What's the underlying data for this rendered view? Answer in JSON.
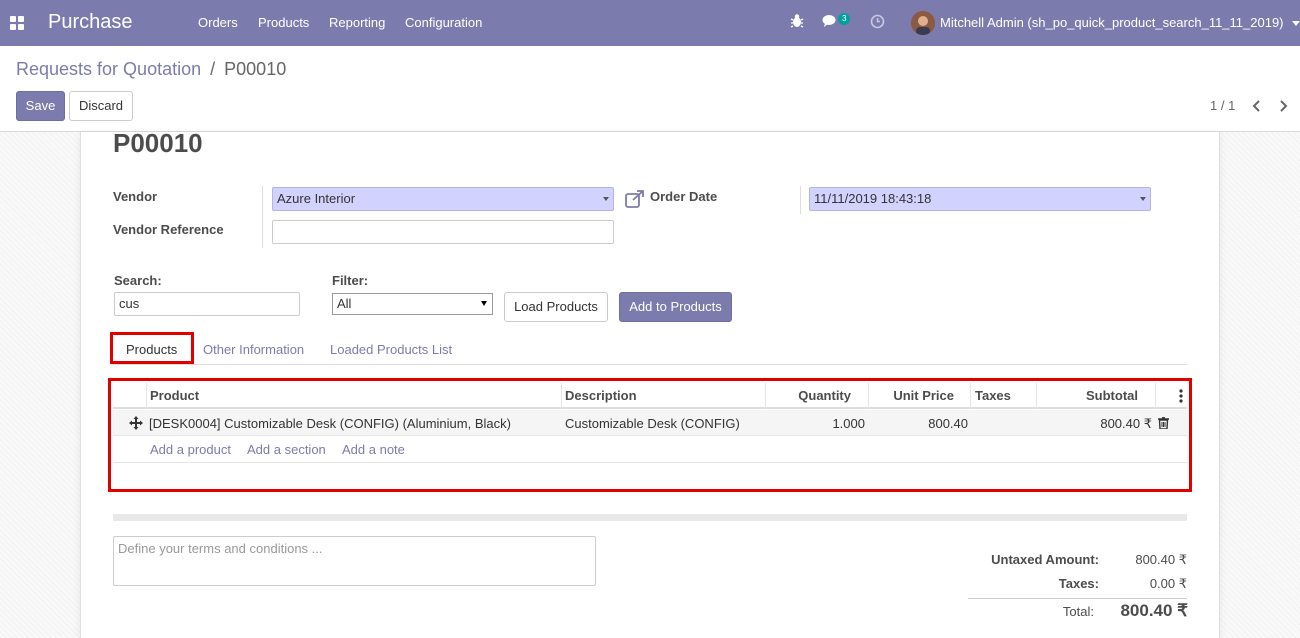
{
  "navbar": {
    "app_name": "Purchase",
    "menu": [
      "Orders",
      "Products",
      "Reporting",
      "Configuration"
    ],
    "chat_count": "3",
    "user": "Mitchell Admin (sh_po_quick_product_search_11_11_2019)",
    "bar_color": "#7c7bad"
  },
  "control": {
    "breadcrumb_parent": "Requests for Quotation",
    "breadcrumb_sep": "/",
    "breadcrumb_current": "P00010",
    "save_label": "Save",
    "discard_label": "Discard",
    "pager": "1 / 1"
  },
  "form": {
    "title": "P00010",
    "vendor_label": "Vendor",
    "vendor_value": "Azure Interior",
    "vendor_ref_label": "Vendor Reference",
    "vendor_ref_value": "",
    "order_date_label": "Order Date",
    "order_date_value": "11/11/2019 18:43:18"
  },
  "quick_search": {
    "search_label": "Search:",
    "search_value": "cus",
    "filter_label": "Filter:",
    "filter_value": "All",
    "load_label": "Load Products",
    "add_label": "Add to Products"
  },
  "tabs": [
    "Products",
    "Other Information",
    "Loaded Products List"
  ],
  "lines": {
    "headers": [
      "Product",
      "Description",
      "Quantity",
      "Unit Price",
      "Taxes",
      "Subtotal"
    ],
    "rows": [
      {
        "product": "[DESK0004] Customizable Desk (CONFIG) (Aluminium, Black)",
        "description": "Customizable Desk (CONFIG)",
        "quantity": "1.000",
        "unit_price": "800.40",
        "taxes": "",
        "subtotal": "800.40 ₹"
      }
    ],
    "add_product": "Add a product",
    "add_section": "Add a section",
    "add_note": "Add a note"
  },
  "notes_placeholder": "Define your terms and conditions ...",
  "totals": {
    "untaxed_label": "Untaxed Amount:",
    "untaxed_value": "800.40 ₹",
    "taxes_label": "Taxes:",
    "taxes_value": "0.00 ₹",
    "total_label": "Total:",
    "total_value": "800.40 ₹"
  },
  "highlight_color": "#e00000"
}
